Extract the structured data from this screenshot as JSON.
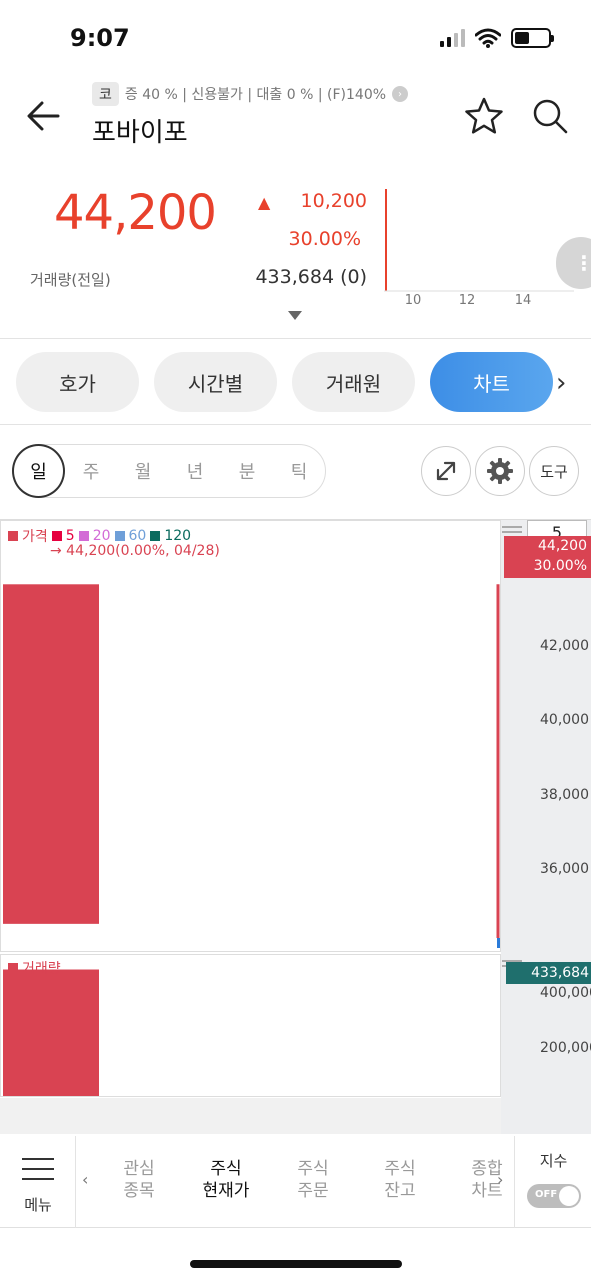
{
  "status_bar": {
    "time": "9:07"
  },
  "header": {
    "market_chip": "코",
    "tags": "증 40 % | 신용불가 | 대출 0 % | (F)140%",
    "stock_name": "포바이포"
  },
  "price": {
    "current": "44,200",
    "change_amount": "10,200",
    "change_percent": "30.00%",
    "volume_label": "거래량(전일)",
    "volume_value": "433,684 (0)",
    "mini_chart_ticks": [
      "10",
      "12",
      "14"
    ]
  },
  "tabs": [
    {
      "label": "호가"
    },
    {
      "label": "시간별"
    },
    {
      "label": "거래원"
    },
    {
      "label": "차트",
      "active": true
    }
  ],
  "periods": [
    "일",
    "주",
    "월",
    "년",
    "분",
    "틱"
  ],
  "tools": {
    "tool_label": "도구"
  },
  "chart_data": {
    "type": "bar",
    "legend": [
      {
        "name": "가격",
        "color": "#d94352"
      },
      {
        "name": "5",
        "color": "#e6003f"
      },
      {
        "name": "20",
        "color": "#d36bd6"
      },
      {
        "name": "60",
        "color": "#6f9fd8"
      },
      {
        "name": "120",
        "color": "#0b6b5e"
      }
    ],
    "last_value_text": "→ 44,200(0.00%, 04/28)",
    "candle_count": "5",
    "price_axis_ticks": [
      "42,000",
      "40,000",
      "38,000",
      "36,000"
    ],
    "price_tag_value": "44,200",
    "price_tag_percent": "30.00%",
    "price_range": [
      34200,
      45000
    ],
    "candles": [
      {
        "date": "04/28",
        "open": 34600,
        "high": 44200,
        "low": 34600,
        "close": 44200
      }
    ],
    "volume_label": "거래량",
    "volume_axis_ticks": [
      "400,000",
      "200,000"
    ],
    "volume_tag_value": "433,684",
    "volume_range": [
      0,
      480000
    ],
    "volumes": [
      433684
    ]
  },
  "bottom_nav": {
    "menu_label": "메뉴",
    "items": [
      {
        "line1": "관심",
        "line2": "종목"
      },
      {
        "line1": "주식",
        "line2": "현재가",
        "active": true
      },
      {
        "line1": "주식",
        "line2": "주문"
      },
      {
        "line1": "주식",
        "line2": "잔고"
      },
      {
        "line1": "종합",
        "line2": "차트"
      }
    ],
    "index_label": "지수",
    "index_toggle": "OFF"
  }
}
